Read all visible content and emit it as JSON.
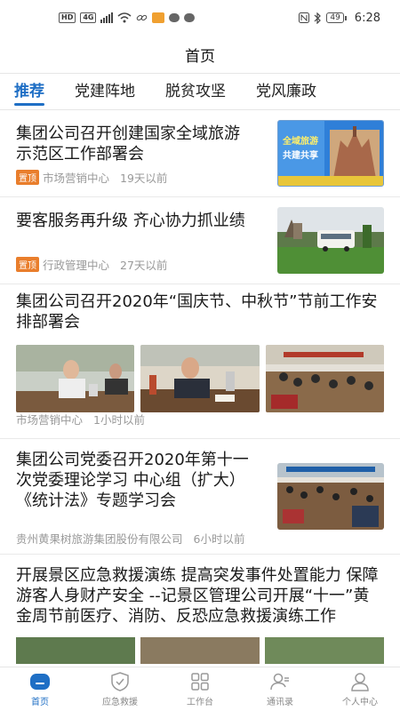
{
  "status_bar": {
    "left_tags": [
      "HD",
      "4G"
    ],
    "battery": "49",
    "time": "6:28"
  },
  "header": {
    "title": "首页"
  },
  "tabs": [
    {
      "label": "推荐",
      "active": true
    },
    {
      "label": "党建阵地",
      "active": false
    },
    {
      "label": "脱贫攻坚",
      "active": false
    },
    {
      "label": "党风廉政",
      "active": false
    }
  ],
  "feed": [
    {
      "title": "集团公司召开创建国家全域旅游示范区工作部署会",
      "pinned": true,
      "pin_label": "置顶",
      "source": "市场营销中心",
      "time": "19天以前",
      "thumbnail_text": [
        "全域旅游",
        "共建共享"
      ]
    },
    {
      "title": " 要客服务再升级  齐心协力抓业绩",
      "pinned": true,
      "pin_label": "置顶",
      "source": "行政管理中心",
      "time": "27天以前"
    },
    {
      "title": "集团公司召开2020年“国庆节、中秋节”节前工作安排部署会",
      "pinned": false,
      "source": "市场营销中心",
      "time": "1小时以前"
    },
    {
      "title": " 集团公司党委召开2020年第十一次党委理论学习  中心组（扩大）《统计法》专题学习会",
      "pinned": false,
      "source": "贵州黄果树旅游集团股份有限公司",
      "time": "6小时以前"
    },
    {
      "title": " 开展景区应急救援演练 提高突发事件处置能力 保障游客人身财产安全  --记景区管理公司开展“十一”黄金周节前医疗、消防、反恐应急救援演练工作",
      "pinned": false
    }
  ],
  "bottom_nav": [
    {
      "label": "首页",
      "icon": "home-icon",
      "active": true
    },
    {
      "label": "应急救援",
      "icon": "shield-check-icon",
      "active": false
    },
    {
      "label": "工作台",
      "icon": "grid-icon",
      "active": false
    },
    {
      "label": "通讯录",
      "icon": "contacts-icon",
      "active": false
    },
    {
      "label": "个人中心",
      "icon": "person-icon",
      "active": false
    }
  ],
  "colors": {
    "accent": "#1f6fc5",
    "pin": "#e97e2c",
    "meta_text": "#999999"
  }
}
